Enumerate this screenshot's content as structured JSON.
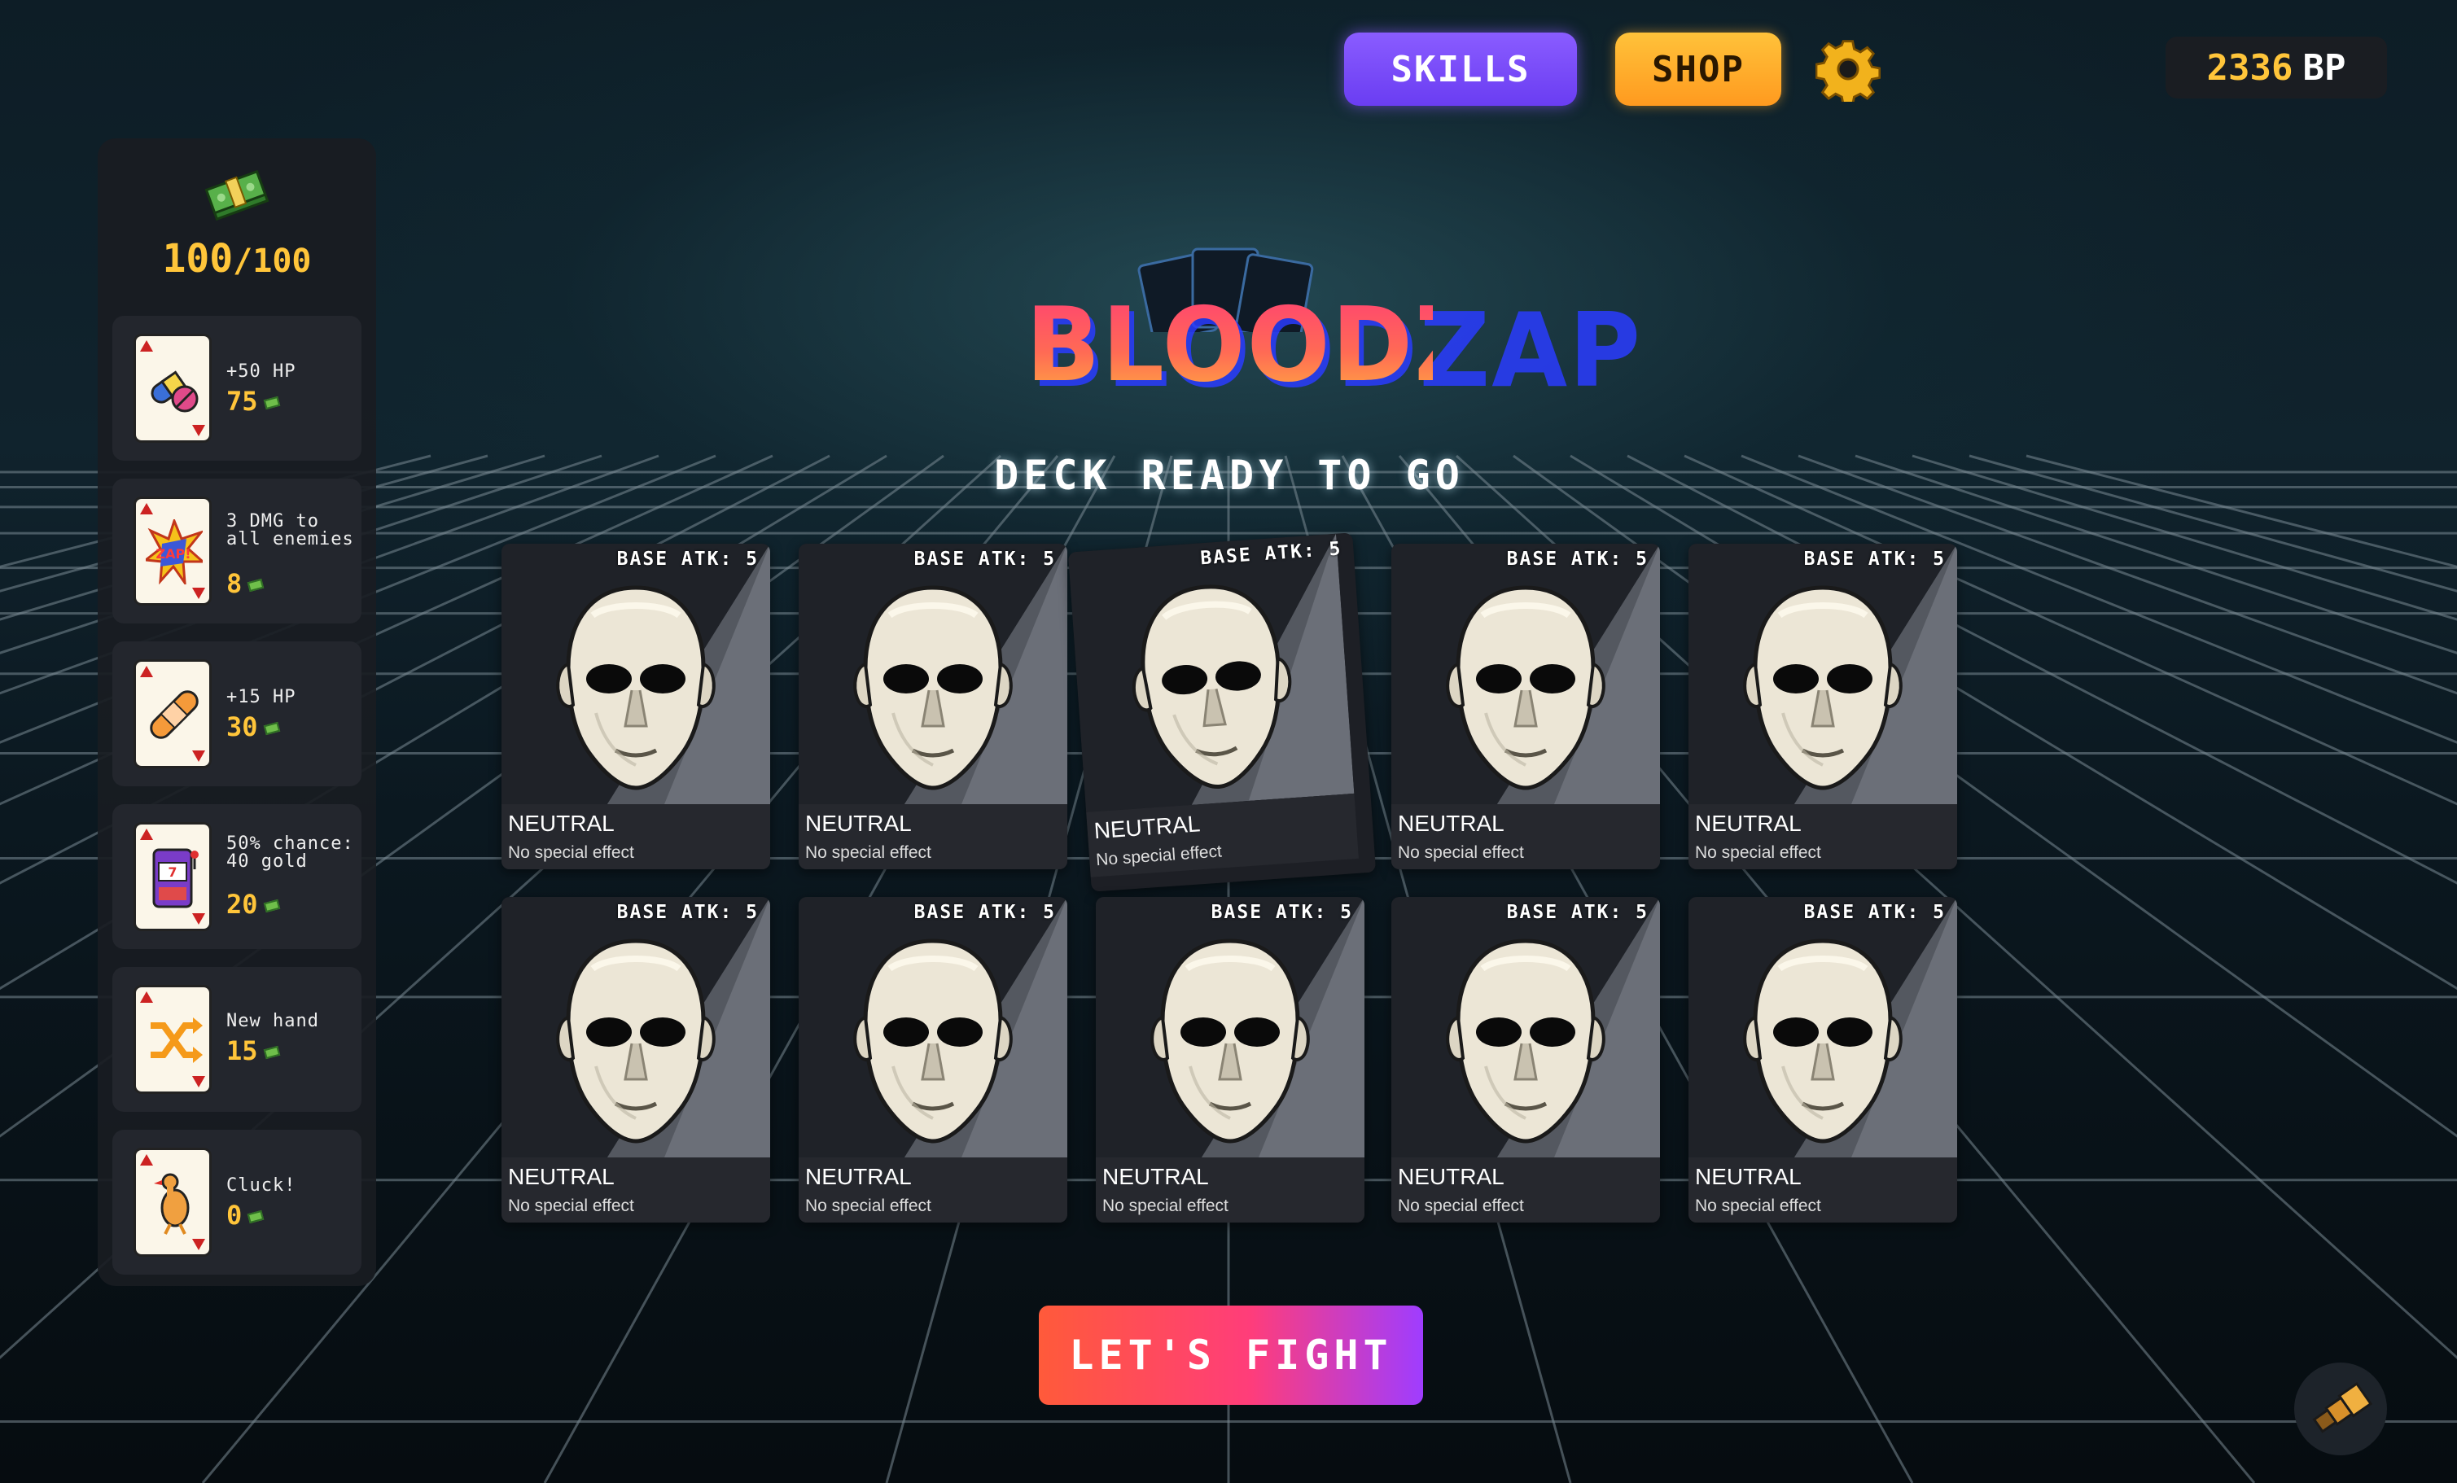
{
  "header": {
    "skills_label": "SKILLS",
    "shop_label": "SHOP",
    "settings_icon": "gear-icon",
    "bp_value": "2336",
    "bp_unit": "BP"
  },
  "sidebar": {
    "gold_current": "100",
    "gold_sep": "/",
    "gold_max": "100",
    "cash_icon": "cash-stack-icon",
    "items": [
      {
        "desc": "+50 HP",
        "price": "75",
        "icon": "pills-icon"
      },
      {
        "desc": "3 DMG to all enemies",
        "price": "8",
        "icon": "zap-icon"
      },
      {
        "desc": "+15 HP",
        "price": "30",
        "icon": "bandage-icon"
      },
      {
        "desc": "50% chance: 40 gold",
        "price": "20",
        "icon": "slot-machine-icon"
      },
      {
        "desc": "New hand",
        "price": "15",
        "icon": "shuffle-icon"
      },
      {
        "desc": "Cluck!",
        "price": "0",
        "icon": "rubber-chicken-icon"
      }
    ]
  },
  "logo": {
    "title": "BLOODZAP"
  },
  "deck": {
    "title": "DECK READY TO GO",
    "cards": [
      {
        "atk": "BASE ATK: 5",
        "type": "NEUTRAL",
        "effect": "No special effect"
      },
      {
        "atk": "BASE ATK: 5",
        "type": "NEUTRAL",
        "effect": "No special effect"
      },
      {
        "atk": "BASE ATK: 5",
        "type": "NEUTRAL",
        "effect": "No special effect"
      },
      {
        "atk": "BASE ATK: 5",
        "type": "NEUTRAL",
        "effect": "No special effect"
      },
      {
        "atk": "BASE ATK: 5",
        "type": "NEUTRAL",
        "effect": "No special effect"
      },
      {
        "atk": "BASE ATK: 5",
        "type": "NEUTRAL",
        "effect": "No special effect"
      },
      {
        "atk": "BASE ATK: 5",
        "type": "NEUTRAL",
        "effect": "No special effect"
      },
      {
        "atk": "BASE ATK: 5",
        "type": "NEUTRAL",
        "effect": "No special effect"
      },
      {
        "atk": "BASE ATK: 5",
        "type": "NEUTRAL",
        "effect": "No special effect"
      },
      {
        "atk": "BASE ATK: 5",
        "type": "NEUTRAL",
        "effect": "No special effect"
      }
    ]
  },
  "fight_label": "LET'S FIGHT",
  "corner_icon": "spyglass-icon",
  "colors": {
    "gold": "#ffc53a",
    "skills": "#7a4cff",
    "shop": "#ffae2a"
  }
}
